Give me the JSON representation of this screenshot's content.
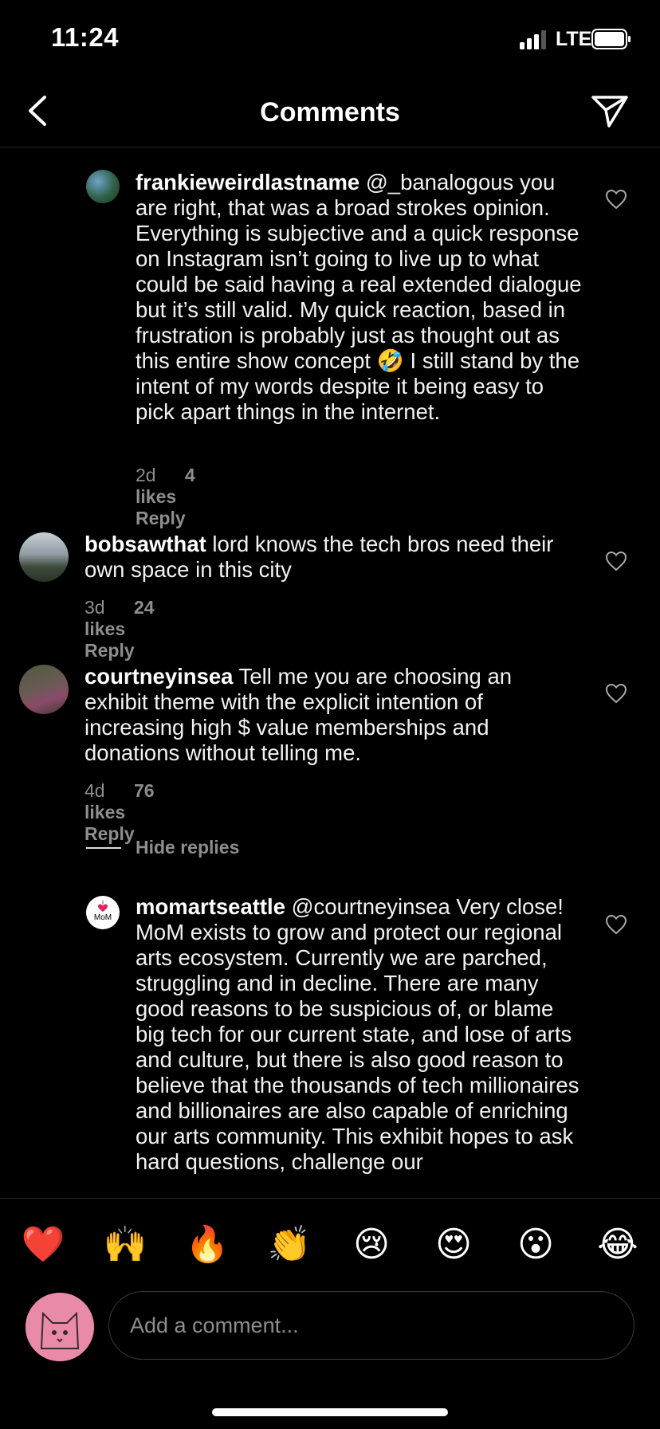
{
  "status": {
    "time": "11:24",
    "network": "LTE"
  },
  "nav": {
    "title": "Comments"
  },
  "comments": [
    {
      "user": "frankieweirdlastname",
      "text": "@_banalogous you are right, that was a broad strokes opinion. Everything is subjective and a quick response on Instagram isn’t going to live up to what could be said having a real extended dialogue but it’s still valid. My quick reaction, based in frustration is probably just as thought out as this entire show concept 🤣 I still stand by the intent of my words despite it being easy to pick apart things in the internet.",
      "time": "2d",
      "likes": "4 likes",
      "reply": "Reply"
    },
    {
      "user": "bobsawthat",
      "text": "lord knows the tech bros need their own space in this city",
      "time": "3d",
      "likes": "24 likes",
      "reply": "Reply"
    },
    {
      "user": "courtneyinsea",
      "text": "Tell me you are choosing an exhibit theme with the explicit intention of increasing high $ value memberships and donations without telling me.",
      "time": "4d",
      "likes": "76 likes",
      "reply": "Reply"
    },
    {
      "user": "momartseattle",
      "text": "@courtneyinsea Very close! MoM exists to grow and protect our regional arts ecosystem. Currently we are parched, struggling and in decline. There are many good reasons to be suspicious of, or blame big tech for our current state, and lose of arts and culture, but there is also good reason to believe that the thousands of tech millionaires and billionaires are also capable of enriching our arts community. This exhibit hopes to ask hard questions, challenge our",
      "avatar_text": "MoM"
    }
  ],
  "hide_replies": "Hide replies",
  "emojis": [
    "❤️",
    "🙌",
    "🔥",
    "👏",
    "😢",
    "😍",
    "😮",
    "😂"
  ],
  "composer": {
    "placeholder": "Add a comment..."
  }
}
